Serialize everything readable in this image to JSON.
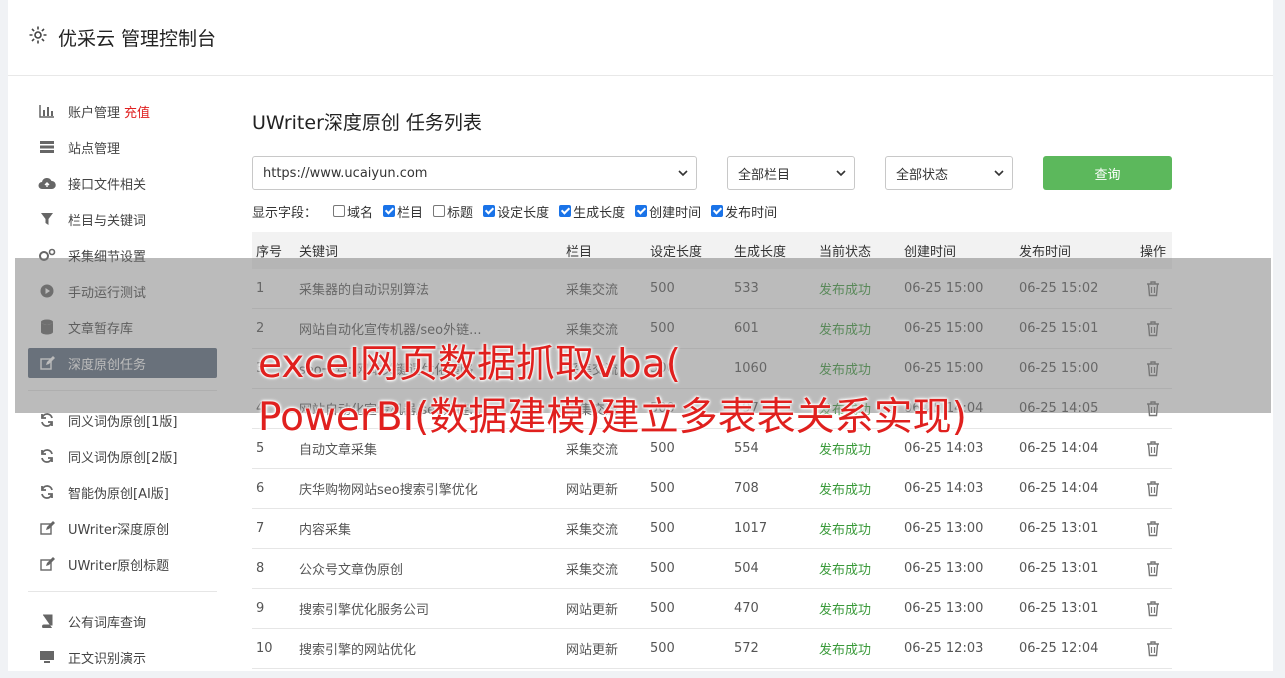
{
  "header": {
    "title": "优采云 管理控制台",
    "icon": "gear-icon"
  },
  "sidebar": {
    "items": [
      {
        "label": "账户管理",
        "extra": "充值",
        "icon": "bar-chart-icon",
        "active": false
      },
      {
        "label": "站点管理",
        "icon": "list-icon",
        "active": false
      },
      {
        "label": "接口文件相关",
        "icon": "cloud-upload-icon",
        "active": false
      },
      {
        "label": "栏目与关键词",
        "icon": "filter-icon",
        "active": false
      },
      {
        "label": "采集细节设置",
        "icon": "gears-icon",
        "active": false
      },
      {
        "label": "手动运行测试",
        "icon": "play-icon",
        "active": false
      },
      {
        "label": "文章暂存库",
        "icon": "database-icon",
        "active": false
      },
      {
        "label": "深度原创任务",
        "icon": "edit-icon",
        "active": true
      }
    ],
    "items2": [
      {
        "label": "同义词伪原创[1版]",
        "icon": "refresh-icon"
      },
      {
        "label": "同义词伪原创[2版]",
        "icon": "refresh-icon"
      },
      {
        "label": "智能伪原创[AI版]",
        "icon": "refresh-icon"
      },
      {
        "label": "UWriter深度原创",
        "icon": "edit-icon"
      },
      {
        "label": "UWriter原创标题",
        "icon": "edit-icon"
      }
    ],
    "items3": [
      {
        "label": "公有词库查询",
        "icon": "book-icon"
      },
      {
        "label": "正文识别演示",
        "icon": "monitor-icon"
      }
    ]
  },
  "main": {
    "title": "UWriter深度原创 任务列表",
    "site_select": "https://www.ucaiyun.com",
    "column_select": "全部栏目",
    "status_select": "全部状态",
    "query_label": "查询",
    "fields_label": "显示字段：",
    "fields": [
      {
        "label": "域名",
        "checked": false
      },
      {
        "label": "栏目",
        "checked": true
      },
      {
        "label": "标题",
        "checked": false
      },
      {
        "label": "设定长度",
        "checked": true
      },
      {
        "label": "生成长度",
        "checked": true
      },
      {
        "label": "创建时间",
        "checked": true
      },
      {
        "label": "发布时间",
        "checked": true
      }
    ]
  },
  "table": {
    "headers": [
      "序号",
      "关键词",
      "栏目",
      "设定长度",
      "生成长度",
      "当前状态",
      "创建时间",
      "发布时间",
      "操作"
    ],
    "rows": [
      [
        "1",
        "采集器的自动识别算法",
        "采集交流",
        "500",
        "533",
        "发布成功",
        "06-25 15:00",
        "06-25 15:02"
      ],
      [
        "2",
        "网站自动化宣传机器/seo外链...",
        "采集交流",
        "500",
        "601",
        "发布成功",
        "06-25 15:00",
        "06-25 15:01"
      ],
      [
        "3",
        "seo一号: 网站关键词优化策略",
        "采集交流",
        "500",
        "1060",
        "发布成功",
        "06-25 15:00",
        "06-25 15:00"
      ],
      [
        "4",
        "网站自动化宣传机器/seo外链...",
        "采集交流",
        "500",
        "497",
        "发布成功",
        "06-25 14:04",
        "06-25 14:05"
      ],
      [
        "5",
        "自动文章采集",
        "采集交流",
        "500",
        "554",
        "发布成功",
        "06-25 14:03",
        "06-25 14:04"
      ],
      [
        "6",
        "庆华购物网站seo搜索引擎优化",
        "网站更新",
        "500",
        "708",
        "发布成功",
        "06-25 14:03",
        "06-25 14:04"
      ],
      [
        "7",
        "内容采集",
        "采集交流",
        "500",
        "1017",
        "发布成功",
        "06-25 13:00",
        "06-25 13:01"
      ],
      [
        "8",
        "公众号文章伪原创",
        "采集交流",
        "500",
        "504",
        "发布成功",
        "06-25 13:00",
        "06-25 13:01"
      ],
      [
        "9",
        "搜索引擎优化服务公司",
        "网站更新",
        "500",
        "470",
        "发布成功",
        "06-25 13:00",
        "06-25 13:01"
      ],
      [
        "10",
        "搜索引擎的网站优化",
        "网站更新",
        "500",
        "572",
        "发布成功",
        "06-25 12:03",
        "06-25 12:04"
      ]
    ]
  },
  "overlay": {
    "line1": "excel网页数据抓取vba(",
    "line2": "PowerBI(数据建模)建立多表表关系实现)"
  },
  "colors": {
    "accent_green": "#5cb85c",
    "active_bg": "#5b6b7e",
    "overlay_text": "#e0201e",
    "success": "#3a9a3a"
  }
}
